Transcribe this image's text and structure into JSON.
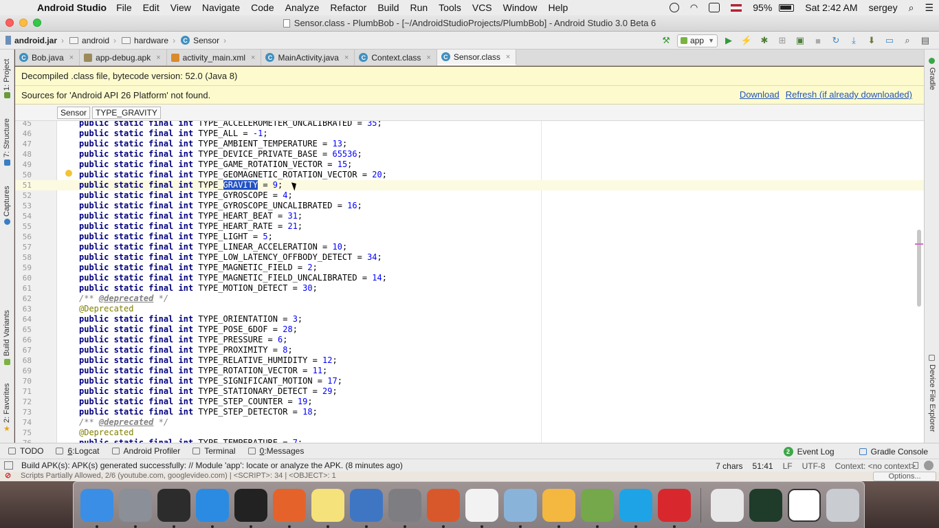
{
  "menubar": {
    "app_name": "Android Studio",
    "items": [
      "File",
      "Edit",
      "View",
      "Navigate",
      "Code",
      "Analyze",
      "Refactor",
      "Build",
      "Run",
      "Tools",
      "VCS",
      "Window",
      "Help"
    ],
    "battery": "95%",
    "clock": "Sat 2:42 AM",
    "user": "sergey"
  },
  "window": {
    "title": "Sensor.class - PlumbBob - [~/AndroidStudioProjects/PlumbBob] - Android Studio 3.0 Beta 6"
  },
  "navbar": {
    "crumbs": [
      "android.jar",
      "android",
      "hardware",
      "Sensor"
    ],
    "run_config": "app"
  },
  "left_tools": [
    "1: Project",
    "7: Structure",
    "Captures",
    "Build Variants",
    "2: Favorites"
  ],
  "right_tools": [
    "Gradle",
    "Device File Explorer"
  ],
  "tabs": [
    {
      "label": "Bob.java",
      "icon": "class-icon",
      "color": "#3f8fbf"
    },
    {
      "label": "app-debug.apk",
      "icon": "apk-icon",
      "color": "#9c8a5a"
    },
    {
      "label": "activity_main.xml",
      "icon": "xml-icon",
      "color": "#d98b2b"
    },
    {
      "label": "MainActivity.java",
      "icon": "class-icon",
      "color": "#3f8fbf"
    },
    {
      "label": "Context.class",
      "icon": "class-icon",
      "color": "#3f8fbf"
    },
    {
      "label": "Sensor.class",
      "icon": "class-icon",
      "color": "#3f8fbf",
      "active": true
    }
  ],
  "banners": {
    "decompiled": "Decompiled .class file, bytecode version: 52.0 (Java 8)",
    "sources_missing": "Sources for 'Android API 26 Platform' not found.",
    "download": "Download",
    "refresh": "Refresh (if already downloaded)"
  },
  "editor_crumbs": [
    "Sensor",
    "TYPE_GRAVITY"
  ],
  "code_lines": [
    {
      "n": "45",
      "kind": "field",
      "name": "TYPE_ACCELEROMETER_UNCALIBRATED",
      "value": "35"
    },
    {
      "n": "46",
      "kind": "field",
      "name": "TYPE_ALL",
      "value": "-1"
    },
    {
      "n": "47",
      "kind": "field",
      "name": "TYPE_AMBIENT_TEMPERATURE",
      "value": "13"
    },
    {
      "n": "48",
      "kind": "field",
      "name": "TYPE_DEVICE_PRIVATE_BASE",
      "value": "65536"
    },
    {
      "n": "49",
      "kind": "field",
      "name": "TYPE_GAME_ROTATION_VECTOR",
      "value": "15"
    },
    {
      "n": "50",
      "kind": "field",
      "name": "TYPE_GEOMAGNETIC_ROTATION_VECTOR",
      "value": "20",
      "bulb": true
    },
    {
      "n": "51",
      "kind": "field",
      "name": "TYPE_GRAVITY",
      "value": "9",
      "current": true,
      "selected": "GRAVITY"
    },
    {
      "n": "52",
      "kind": "field",
      "name": "TYPE_GYROSCOPE",
      "value": "4"
    },
    {
      "n": "53",
      "kind": "field",
      "name": "TYPE_GYROSCOPE_UNCALIBRATED",
      "value": "16"
    },
    {
      "n": "54",
      "kind": "field",
      "name": "TYPE_HEART_BEAT",
      "value": "31"
    },
    {
      "n": "55",
      "kind": "field",
      "name": "TYPE_HEART_RATE",
      "value": "21"
    },
    {
      "n": "56",
      "kind": "field",
      "name": "TYPE_LIGHT",
      "value": "5"
    },
    {
      "n": "57",
      "kind": "field",
      "name": "TYPE_LINEAR_ACCELERATION",
      "value": "10"
    },
    {
      "n": "58",
      "kind": "field",
      "name": "TYPE_LOW_LATENCY_OFFBODY_DETECT",
      "value": "34"
    },
    {
      "n": "59",
      "kind": "field",
      "name": "TYPE_MAGNETIC_FIELD",
      "value": "2"
    },
    {
      "n": "60",
      "kind": "field",
      "name": "TYPE_MAGNETIC_FIELD_UNCALIBRATED",
      "value": "14"
    },
    {
      "n": "61",
      "kind": "field",
      "name": "TYPE_MOTION_DETECT",
      "value": "30"
    },
    {
      "n": "62",
      "kind": "deprecated_comment"
    },
    {
      "n": "63",
      "kind": "annotation",
      "text": "@Deprecated"
    },
    {
      "n": "64",
      "kind": "field",
      "name": "TYPE_ORIENTATION",
      "value": "3"
    },
    {
      "n": "65",
      "kind": "field",
      "name": "TYPE_POSE_6DOF",
      "value": "28"
    },
    {
      "n": "66",
      "kind": "field",
      "name": "TYPE_PRESSURE",
      "value": "6"
    },
    {
      "n": "67",
      "kind": "field",
      "name": "TYPE_PROXIMITY",
      "value": "8"
    },
    {
      "n": "68",
      "kind": "field",
      "name": "TYPE_RELATIVE_HUMIDITY",
      "value": "12"
    },
    {
      "n": "69",
      "kind": "field",
      "name": "TYPE_ROTATION_VECTOR",
      "value": "11"
    },
    {
      "n": "70",
      "kind": "field",
      "name": "TYPE_SIGNIFICANT_MOTION",
      "value": "17"
    },
    {
      "n": "71",
      "kind": "field",
      "name": "TYPE_STATIONARY_DETECT",
      "value": "29"
    },
    {
      "n": "72",
      "kind": "field",
      "name": "TYPE_STEP_COUNTER",
      "value": "19"
    },
    {
      "n": "73",
      "kind": "field",
      "name": "TYPE_STEP_DETECTOR",
      "value": "18"
    },
    {
      "n": "74",
      "kind": "deprecated_comment"
    },
    {
      "n": "75",
      "kind": "annotation",
      "text": "@Deprecated"
    },
    {
      "n": "76",
      "kind": "field",
      "name": "TYPE_TEMPERATURE",
      "value": "7"
    }
  ],
  "code_tokens": {
    "modifiers": "public static final int",
    "comment_open": "/** ",
    "comment_tag": "@deprecated",
    "comment_close": " */"
  },
  "bottom_tools": {
    "left": [
      {
        "label": "TODO",
        "mnemonic": ""
      },
      {
        "label": "Logcat",
        "mnemonic": "6"
      },
      {
        "label": "Android Profiler",
        "mnemonic": ""
      },
      {
        "label": "Terminal",
        "mnemonic": ""
      },
      {
        "label": "Messages",
        "mnemonic": "0"
      }
    ],
    "event_log": "Event Log",
    "event_count": "2",
    "gradle_console": "Gradle Console"
  },
  "statusbar": {
    "message": "Build APK(s): APK(s) generated successfully: // Module 'app': locate or analyze the APK. (8 minutes ago)",
    "chars": "7 chars",
    "position": "51:41",
    "line_sep": "LF",
    "encoding": "UTF-8",
    "context": "Context: <no context>"
  },
  "notification": {
    "text": "Scripts Partially Allowed, 2/6 (youtube.com, googlevideo.com) | <SCRIPT>: 34 | <OBJECT>: 1",
    "options": "Options..."
  },
  "dock": [
    {
      "name": "finder",
      "color": "#3a8ee6"
    },
    {
      "name": "launchpad",
      "color": "#8a8f98"
    },
    {
      "name": "dashboard",
      "color": "#2c2c2c"
    },
    {
      "name": "safari",
      "color": "#2b8be3"
    },
    {
      "name": "terminal",
      "color": "#222222"
    },
    {
      "name": "firefox",
      "color": "#e5632a"
    },
    {
      "name": "notes",
      "color": "#f6e27a"
    },
    {
      "name": "keynote",
      "color": "#3f76c4"
    },
    {
      "name": "system-preferences",
      "color": "#7d7d82"
    },
    {
      "name": "firefox-developer",
      "color": "#d9582b"
    },
    {
      "name": "slack",
      "color": "#f2f2f2"
    },
    {
      "name": "preview",
      "color": "#8ab3d9"
    },
    {
      "name": "android-studio",
      "color": "#f4b73f"
    },
    {
      "name": "app-green",
      "color": "#74a84a"
    },
    {
      "name": "skype",
      "color": "#1ea4e6"
    },
    {
      "name": "vivaldi",
      "color": "#d8272d"
    },
    {
      "name": "document-stack",
      "color": "#e8e8e8"
    },
    {
      "name": "android-security-internals",
      "color": "#1f3b2a"
    },
    {
      "name": "blank-window",
      "color": "#ffffff"
    },
    {
      "name": "trash",
      "color": "#c9ccd1"
    }
  ]
}
